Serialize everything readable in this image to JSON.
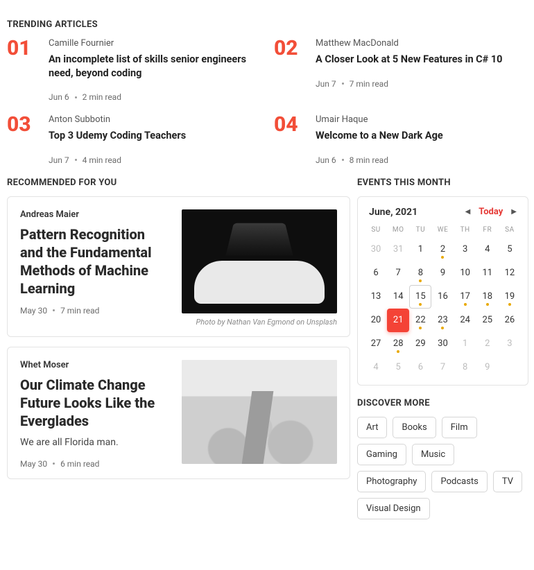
{
  "sections": {
    "trending": "TRENDING ARTICLES",
    "recommended": "RECOMMENDED FOR YOU",
    "events": "EVENTS THIS MONTH",
    "discover": "DISCOVER MORE"
  },
  "trending": [
    {
      "n": "01",
      "author": "Camille Fournier",
      "title": "An incomplete list of skills senior engineers need, beyond coding",
      "date": "Jun 6",
      "read": "2 min read"
    },
    {
      "n": "02",
      "author": "Matthew MacDonald",
      "title": "A Closer Look at 5 New Features in C# 10",
      "date": "Jun 7",
      "read": "7 min read"
    },
    {
      "n": "03",
      "author": "Anton Subbotin",
      "title": "Top 3 Udemy Coding Teachers",
      "date": "Jun 7",
      "read": "4 min read"
    },
    {
      "n": "04",
      "author": "Umair Haque",
      "title": "Welcome to a New Dark Age",
      "date": "Jun 6",
      "read": "8 min read"
    }
  ],
  "recommended": [
    {
      "author": "Andreas Maier",
      "title": "Pattern Recognition and the Fundamental Methods of Machine Learning",
      "snippet": "",
      "date": "May 30",
      "read": "7 min read",
      "caption": "Photo by Nathan Van Egmond on Unsplash",
      "thumb": "car"
    },
    {
      "author": "Whet Moser",
      "title": "Our Climate Change Future Looks Like the Everglades",
      "snippet": "We are all Florida man.",
      "date": "May 30",
      "read": "6 min read",
      "caption": "",
      "thumb": "ever"
    }
  ],
  "calendar": {
    "title": "June, 2021",
    "today_label": "Today",
    "dow": [
      "SU",
      "MO",
      "TU",
      "WE",
      "TH",
      "FR",
      "SA"
    ],
    "prev_tail": [
      30,
      31
    ],
    "days": 30,
    "next_head": 9,
    "outlined": 15,
    "selected": 21,
    "events": [
      2,
      8,
      15,
      17,
      18,
      19,
      22,
      23,
      28
    ]
  },
  "discover": [
    "Art",
    "Books",
    "Film",
    "Gaming",
    "Music",
    "Photography",
    "Podcasts",
    "TV",
    "Visual Design"
  ]
}
